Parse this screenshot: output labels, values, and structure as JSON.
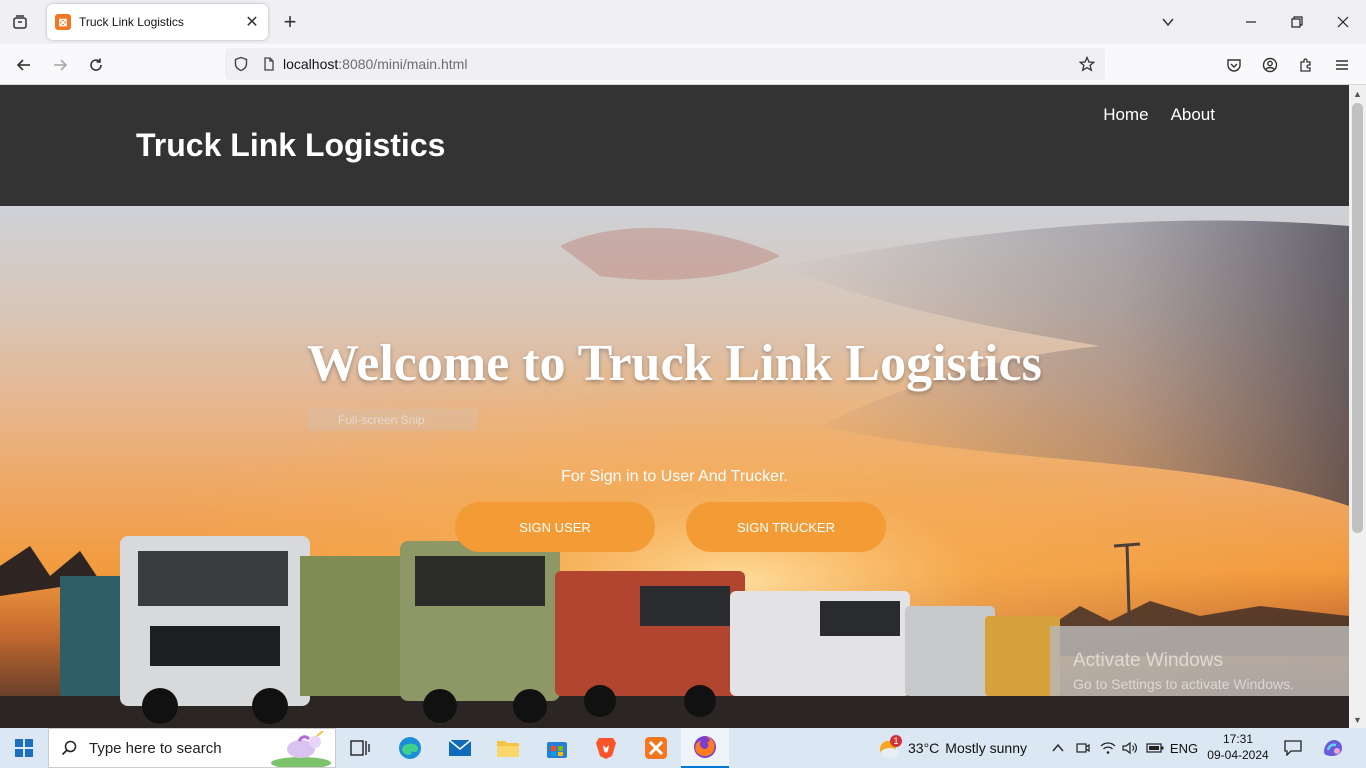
{
  "browser": {
    "tab_title": "Truck Link Logistics",
    "url_host": "localhost",
    "url_path": ":8080/mini/main.html"
  },
  "site": {
    "title": "Truck Link Logistics",
    "nav": [
      "Home",
      "About"
    ],
    "hero_title": "Welcome to Truck Link Logistics",
    "snip_label": "Full-screen Snip",
    "hero_subtitle": "For Sign in to User And Trucker.",
    "btn_user": "SIGN USER",
    "btn_trucker": "SIGN TRUCKER",
    "accent_color": "#f39c35",
    "header_color": "#333333"
  },
  "watermark": {
    "line1": "Activate Windows",
    "line2": "Go to Settings to activate Windows."
  },
  "taskbar": {
    "search_placeholder": "Type here to search",
    "weather_temp": "33°C",
    "weather_desc": "Mostly sunny",
    "weather_badge": "1",
    "lang": "ENG",
    "time": "17:31",
    "date": "09-04-2024",
    "apps": [
      "task-view-icon",
      "edge-icon",
      "mail-icon",
      "file-explorer-icon",
      "store-icon",
      "brave-icon",
      "xampp-icon",
      "firefox-icon"
    ]
  }
}
